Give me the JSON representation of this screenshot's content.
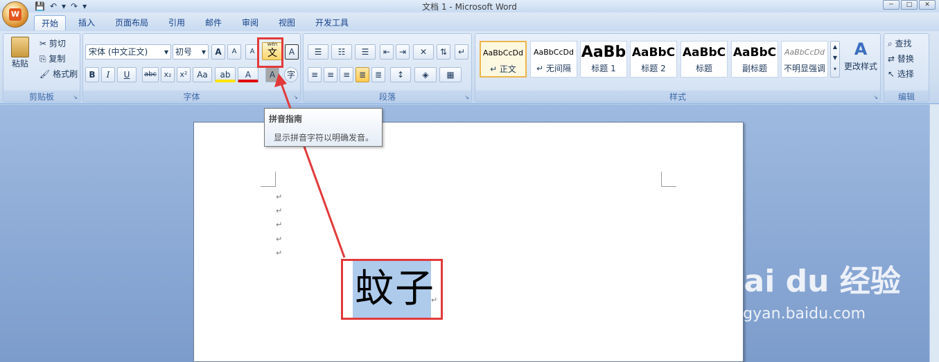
{
  "window": {
    "title": "文档 1 - Microsoft Word",
    "office_letter": "W"
  },
  "qat": {
    "save": "💾",
    "undo": "↶",
    "redo": "↷",
    "more": "▾"
  },
  "window_controls": {
    "min": "─",
    "max": "□",
    "close": "✕"
  },
  "tabs": [
    "开始",
    "插入",
    "页面布局",
    "引用",
    "邮件",
    "审阅",
    "视图",
    "开发工具"
  ],
  "clipboard": {
    "paste": "粘贴",
    "cut": "剪切",
    "copy": "复制",
    "format_painter": "格式刷",
    "label": "剪贴板"
  },
  "font": {
    "name": "宋体 (中文正文)",
    "size": "初号",
    "grow": "A",
    "shrink": "A",
    "clear": "A",
    "phonetic": "文",
    "phonetic_small": "wén",
    "border": "A",
    "bold": "B",
    "italic": "I",
    "underline": "U",
    "strike": "abc",
    "sub": "x₂",
    "sup": "x²",
    "case": "Aa",
    "highlight": "ab",
    "color": "A",
    "shading": "A",
    "enclose": "字",
    "label": "字体"
  },
  "paragraph": {
    "label": "段落"
  },
  "styles": {
    "label": "样式",
    "items": [
      {
        "sample": "AaBbCcDd",
        "name": "↵ 正文"
      },
      {
        "sample": "AaBbCcDd",
        "name": "↵ 无间隔"
      },
      {
        "sample": "AaBb",
        "name": "标题 1"
      },
      {
        "sample": "AaBbC",
        "name": "标题 2"
      },
      {
        "sample": "AaBbC",
        "name": "标题"
      },
      {
        "sample": "AaBbC",
        "name": "副标题"
      },
      {
        "sample": "AaBbCcDd",
        "name": "不明显强调"
      }
    ],
    "change": "更改样式"
  },
  "editing": {
    "find": "查找",
    "replace": "替换",
    "select": "选择",
    "label": "编辑"
  },
  "tooltip": {
    "title": "拼音指南",
    "desc": "显示拼音字符以明确发音。"
  },
  "document": {
    "para_mark": "↵",
    "text": "蚊子",
    "end_mark": "↵"
  },
  "watermark": {
    "brand": "Bai du 经验",
    "url": "jingyan.baidu.com"
  },
  "colors": {
    "highlight_red": "#e23a3a",
    "selection": "#aecbec"
  }
}
